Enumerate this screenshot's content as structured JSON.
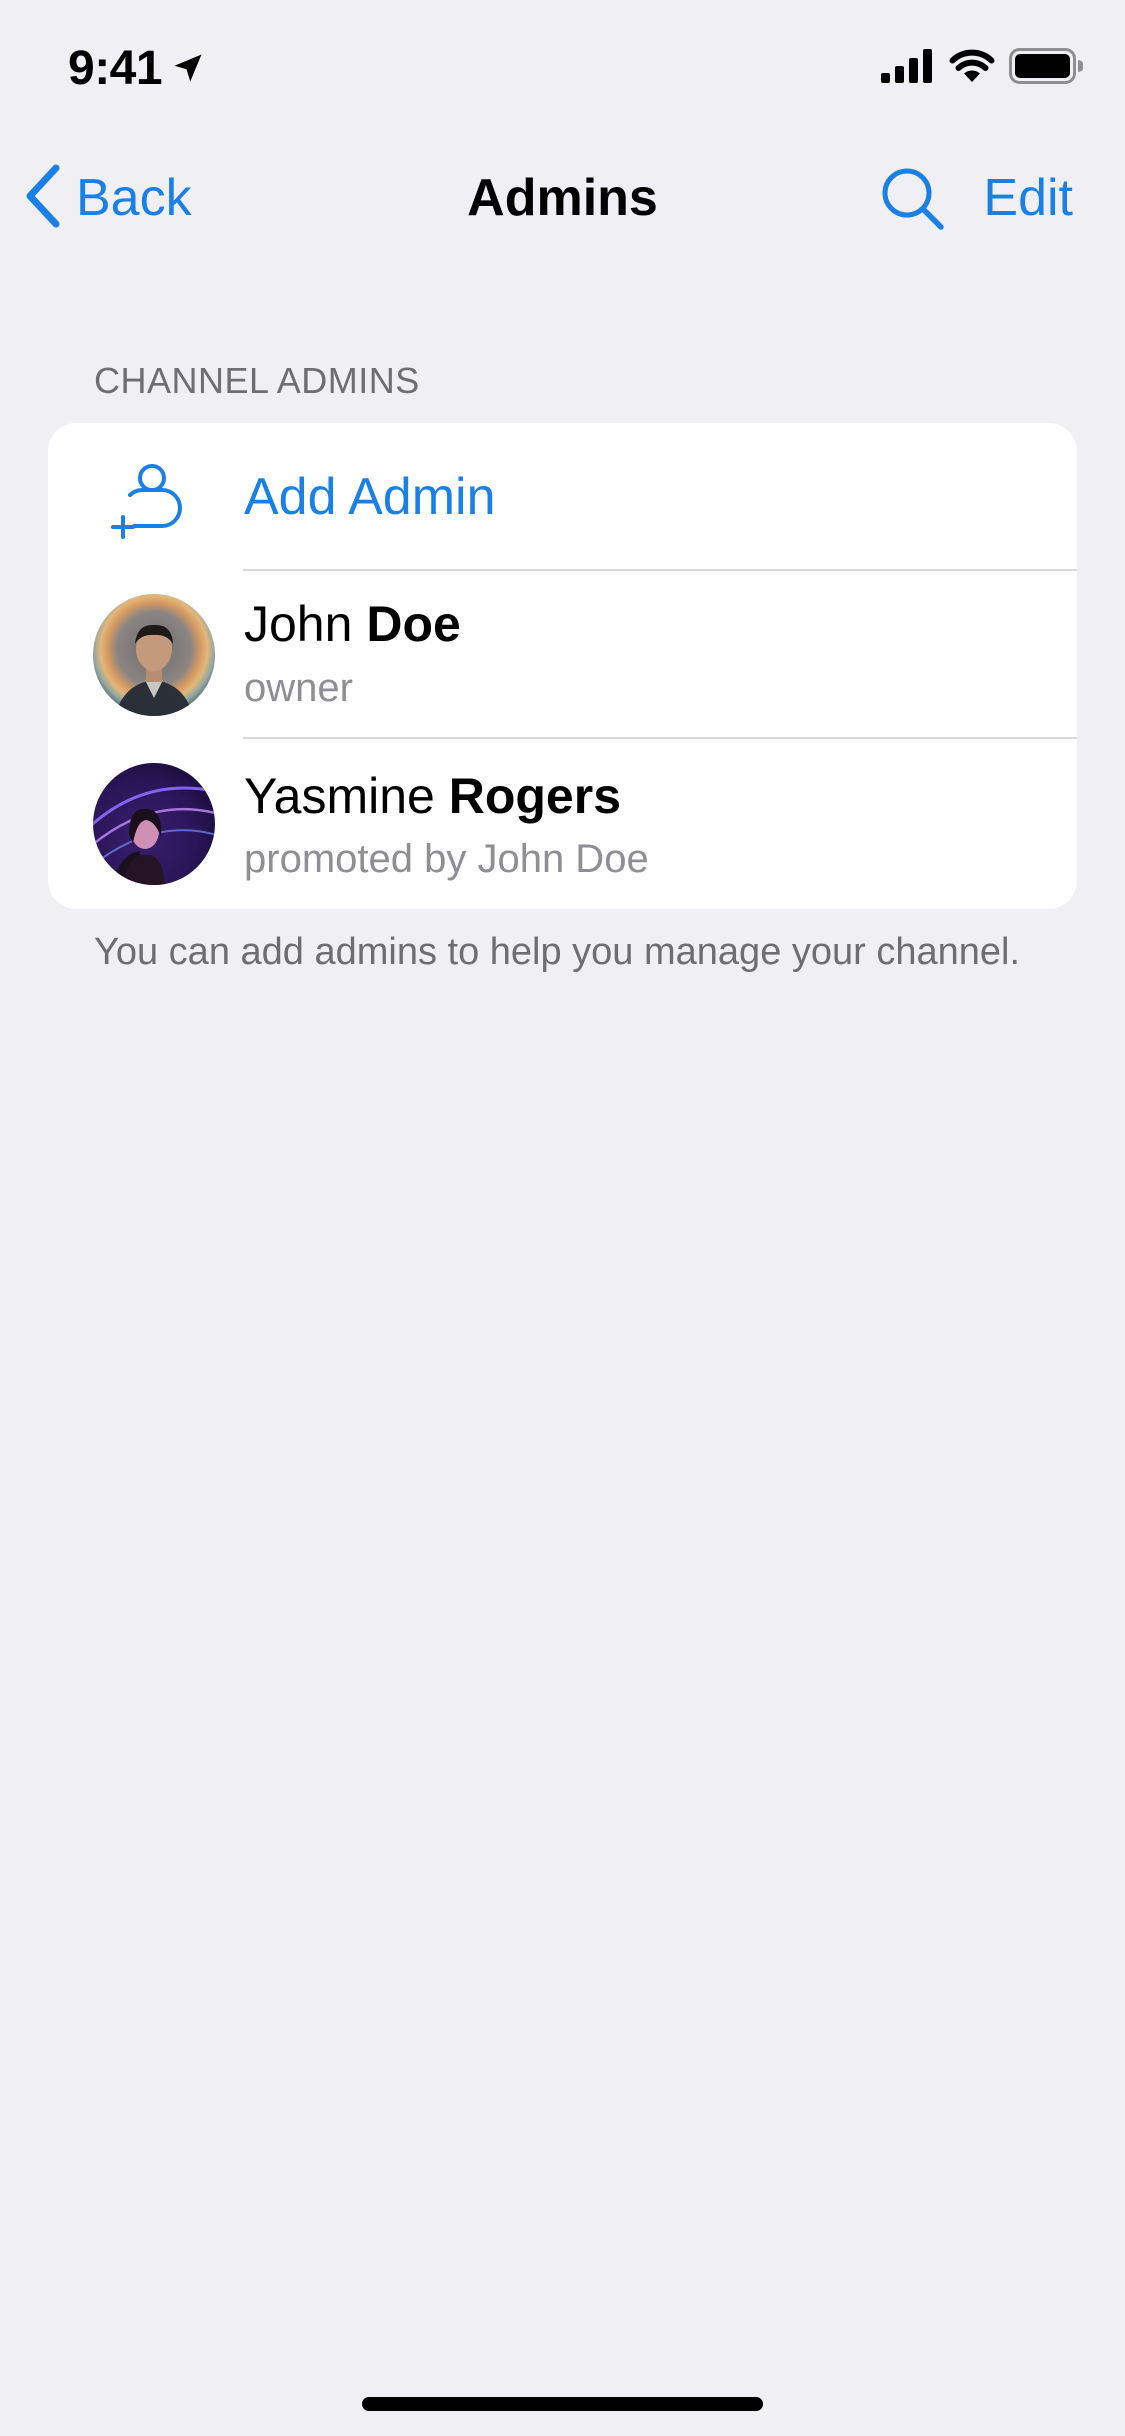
{
  "status_bar": {
    "time": "9:41"
  },
  "nav": {
    "back_label": "Back",
    "title": "Admins",
    "edit_label": "Edit"
  },
  "section": {
    "header": "CHANNEL ADMINS",
    "add_admin_label": "Add Admin",
    "admins": [
      {
        "first_name": "John",
        "last_name": "Doe",
        "subtitle": "owner"
      },
      {
        "first_name": "Yasmine",
        "last_name": "Rogers",
        "subtitle": "promoted by John Doe"
      }
    ],
    "footer": "You can add admins to help you manage your channel."
  },
  "colors": {
    "accent": "#1A80E6",
    "background": "#EFEFF4",
    "card": "#FFFFFF",
    "secondary_text": "#8E8E93"
  },
  "icons": {
    "back": "chevron-left-icon",
    "search": "search-icon",
    "add_admin": "add-person-icon",
    "location": "location-arrow-icon",
    "signal": "cellular-signal-icon",
    "wifi": "wifi-icon",
    "battery": "battery-icon"
  }
}
